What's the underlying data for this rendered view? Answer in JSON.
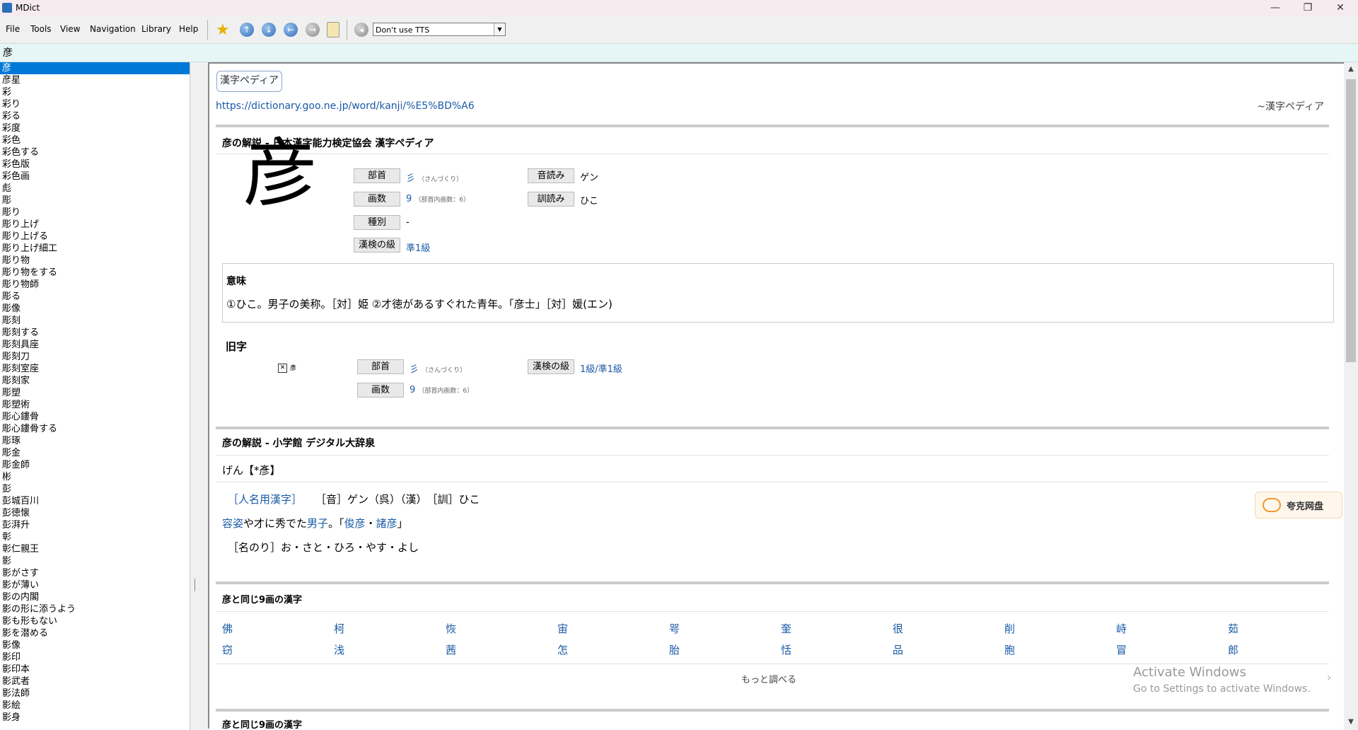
{
  "window": {
    "title": "MDict",
    "min": "—",
    "max": "❐",
    "close": "✕"
  },
  "menu": [
    "File",
    "Tools",
    "View",
    "Navigation",
    "Library",
    "Help"
  ],
  "toolbar": {
    "tts": "Don't use TTS",
    "icons": [
      "star-icon",
      "up-arrow-icon",
      "down-arrow-icon",
      "back-arrow-icon",
      "forward-arrow-icon",
      "clipboard-icon",
      "speaker-icon"
    ]
  },
  "search": {
    "value": "彦"
  },
  "wordlist": [
    "彦",
    "彦星",
    "彩",
    "彩り",
    "彩る",
    "彩度",
    "彩色",
    "彩色する",
    "彩色版",
    "彩色画",
    "彪",
    "彫",
    "彫り",
    "彫り上げ",
    "彫り上げる",
    "彫り上げ細工",
    "彫り物",
    "彫り物をする",
    "彫り物師",
    "彫る",
    "彫像",
    "彫刻",
    "彫刻する",
    "彫刻具座",
    "彫刻刀",
    "彫刻室座",
    "彫刻家",
    "彫塑",
    "彫塑術",
    "彫心鏤骨",
    "彫心鏤骨する",
    "彫琢",
    "彫金",
    "彫金師",
    "彬",
    "彭",
    "彭城百川",
    "彭徳懐",
    "彭湃升",
    "彰",
    "彰仁親王",
    "影",
    "影がさす",
    "影が薄い",
    "影の内閣",
    "影の形に添うよう",
    "影も形もない",
    "影を潜める",
    "影像",
    "影印",
    "影印本",
    "影武者",
    "影法師",
    "影絵",
    "影身"
  ],
  "entry": {
    "dict_tab": "漢字ペディア",
    "url": "https://dictionary.goo.ne.jp/word/kanji/%E5%BD%A6",
    "source": "~漢字ペディア",
    "section1": "彦の解説 - 日本漢字能力検定協会 漢字ペディア",
    "kanji": "彦",
    "labels": {
      "bushu": "部首",
      "kakusu": "画数",
      "shubetsu": "種別",
      "kyu": "漢検の級",
      "on": "音読み",
      "kun": "訓読み"
    },
    "bushu_val": "彡",
    "bushu_sub": "（さんづくり）",
    "kakusu_val": "9",
    "kakusu_sub": "（部首内画数：6）",
    "shubetsu_val": "-",
    "kyu_val": "準1級",
    "on_val": "ゲン",
    "kun_val": "ひこ",
    "imi_title": "意味",
    "imi_text": "①ひこ。男子の美称。［対］姫 ②才徳があるすぐれた青年。「彦士」［対］媛(エン)",
    "kyuji_title": "旧字",
    "kyuji_char": "彥",
    "kyuji_bushu": "彡",
    "kyuji_bushu_sub": "（さんづくり）",
    "kyuji_kakusu": "9",
    "kyuji_kakusu_sub": "（部首内画数：6）",
    "kyuji_kyu": "1級/準1級",
    "section2": "彦の解説 - 小学館 デジタル大辞泉",
    "reading": "げん【*彥】",
    "jinmei": "［人名用漢字］",
    "on_kun": "［音］ゲン（呉）（漢）　［訓］ひこ",
    "def_a": "容姿",
    "def_b": "や才に秀でた",
    "def_c": "男子",
    "def_d": "。「",
    "def_e": "俊彦",
    "def_f": "・",
    "def_g": "諸彦",
    "def_h": "」",
    "nanori": "［名のり］お・さと・ひろ・やす・よし",
    "section3": "彦と同じ9画の漢字",
    "row1": [
      "佛",
      "柯",
      "恢",
      "宙",
      "咢",
      "奎",
      "很",
      "削",
      "峙",
      "茹"
    ],
    "row2": [
      "窃",
      "浅",
      "茜",
      "怎",
      "胎",
      "恬",
      "品",
      "胞",
      "冒",
      "郎"
    ],
    "more": "もっと調べる",
    "section4": "彦と同じ9画の漢字",
    "activate1": "Activate Windows",
    "activate2": "Go to Settings to activate Windows.",
    "cloud": "夸克网盘"
  }
}
